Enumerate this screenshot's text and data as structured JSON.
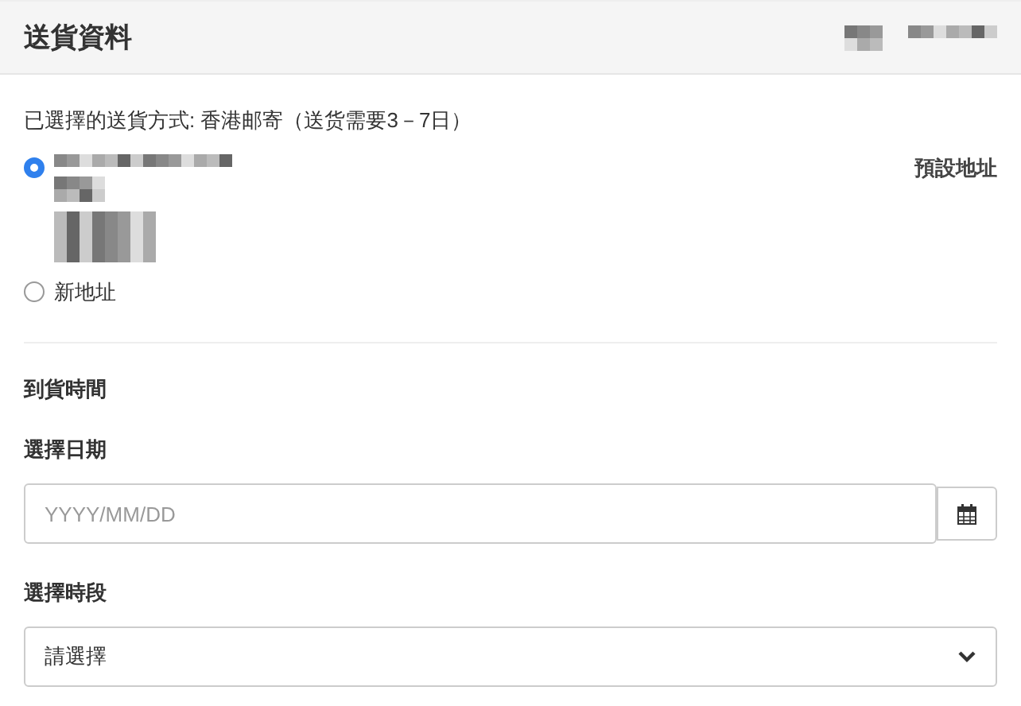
{
  "header": {
    "title": "送貨資料"
  },
  "shipping_method": "已選擇的送貨方式: 香港邮寄（送货需要3－7日）",
  "addresses": [
    {
      "kind": "saved",
      "selected": true,
      "badge": "預設地址"
    },
    {
      "kind": "new",
      "selected": false,
      "label": "新地址"
    }
  ],
  "delivery": {
    "heading": "到貨時間",
    "date_label": "選擇日期",
    "date_placeholder": "YYYY/MM/DD",
    "slot_label": "選擇時段",
    "slot_value": "請選擇"
  }
}
